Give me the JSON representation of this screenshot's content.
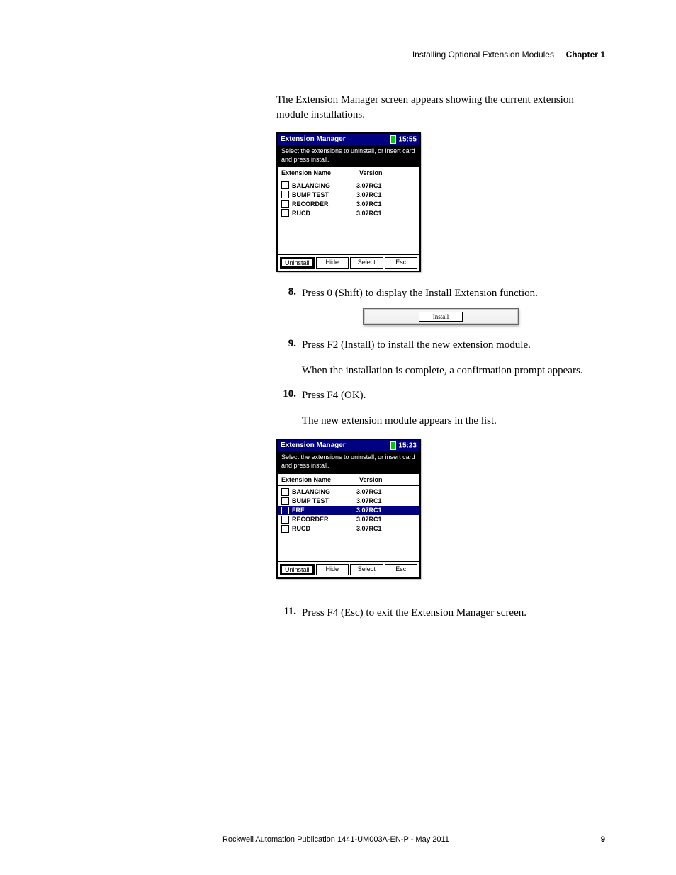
{
  "header": {
    "section": "Installing Optional Extension Modules",
    "chapter_label": "Chapter 1"
  },
  "intro_text": "The Extension Manager screen appears showing the current extension module installations.",
  "screenshot1": {
    "title": "Extension Manager",
    "time": "15:55",
    "instruction": "Select the extensions to uninstall, or insert card and press install.",
    "col_name": "Extension Name",
    "col_ver": "Version",
    "rows": [
      {
        "name": "BALANCING",
        "ver": "3.07RC1"
      },
      {
        "name": "BUMP TEST",
        "ver": "3.07RC1"
      },
      {
        "name": "RECORDER",
        "ver": "3.07RC1"
      },
      {
        "name": "RUCD",
        "ver": "3.07RC1"
      }
    ],
    "buttons": [
      "Uninstall",
      "Hide",
      "Select",
      "Esc"
    ]
  },
  "step8": {
    "num": "8.",
    "text": "Press 0 (Shift) to display the Install Extension function."
  },
  "install_button_label": "Install",
  "step9": {
    "num": "9.",
    "text": "Press F2 (Install) to install the new extension module."
  },
  "step9_followup": "When the installation is complete, a confirmation prompt appears.",
  "step10": {
    "num": "10.",
    "text": "Press F4 (OK)."
  },
  "step10_followup": "The new extension module appears in the list.",
  "screenshot2": {
    "title": "Extension Manager",
    "time": "15:23",
    "instruction": "Select the extensions to uninstall, or insert card and press install.",
    "col_name": "Extension Name",
    "col_ver": "Version",
    "rows": [
      {
        "name": "BALANCING",
        "ver": "3.07RC1",
        "selected": false
      },
      {
        "name": "BUMP TEST",
        "ver": "3.07RC1",
        "selected": false
      },
      {
        "name": "FRF",
        "ver": "3.07RC1",
        "selected": true
      },
      {
        "name": "RECORDER",
        "ver": "3.07RC1",
        "selected": false
      },
      {
        "name": "RUCD",
        "ver": "3.07RC1",
        "selected": false
      }
    ],
    "buttons": [
      "Uninstall",
      "Hide",
      "Select",
      "Esc"
    ]
  },
  "step11": {
    "num": "11.",
    "text": "Press F4 (Esc) to exit the Extension Manager screen."
  },
  "footer": {
    "pub": "Rockwell Automation Publication 1441-UM003A-EN-P - May 2011",
    "page": "9"
  }
}
